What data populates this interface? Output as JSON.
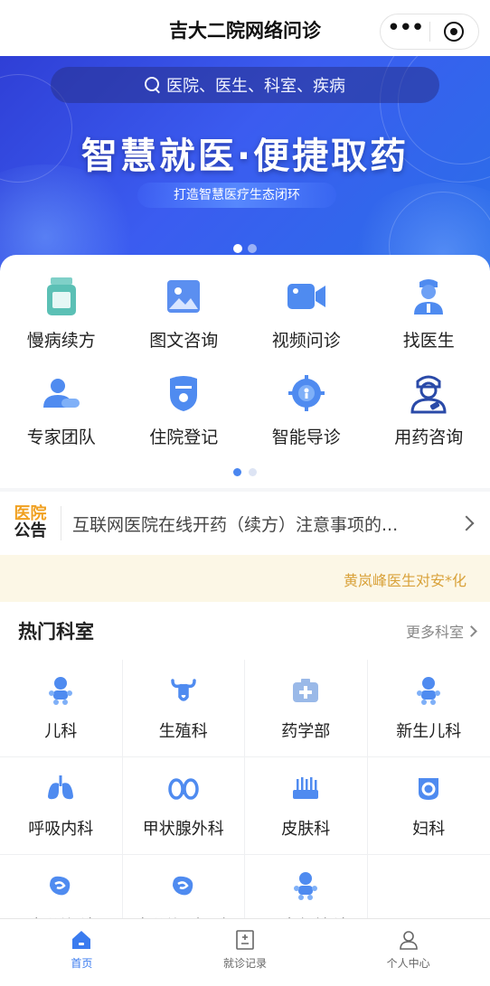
{
  "app": {
    "title": "吉大二院网络问诊"
  },
  "banner": {
    "search_placeholder": "医院、医生、科室、疾病",
    "slogan": "智慧就医·便捷取药",
    "subtitle": "打造智慧医疗生态闭环",
    "slide_count": 2,
    "active_slide": 1
  },
  "services": {
    "items": [
      {
        "label": "慢病续方",
        "icon": "medicine-bottle-icon"
      },
      {
        "label": "图文咨询",
        "icon": "image-icon"
      },
      {
        "label": "视频问诊",
        "icon": "video-camera-icon"
      },
      {
        "label": "找医生",
        "icon": "doctor-icon"
      },
      {
        "label": "专家团队",
        "icon": "team-icon"
      },
      {
        "label": "住院登记",
        "icon": "inpatient-badge-icon"
      },
      {
        "label": "智能导诊",
        "icon": "guide-target-icon"
      },
      {
        "label": "用药咨询",
        "icon": "nurse-icon"
      }
    ],
    "page_count": 2,
    "active_page": 1
  },
  "notice": {
    "tag_line1": "医院",
    "tag_line2": "公告",
    "text": "互联网医院在线开药（续方）注意事项的..."
  },
  "marquee": {
    "text": "黄岚峰医生对安*化"
  },
  "hot_departments": {
    "title": "热门科室",
    "more_label": "更多科室",
    "items": [
      {
        "label": "儿科",
        "icon": "baby-icon"
      },
      {
        "label": "生殖科",
        "icon": "uterus-icon"
      },
      {
        "label": "药学部",
        "icon": "medicine-box-icon"
      },
      {
        "label": "新生儿科",
        "icon": "newborn-icon"
      },
      {
        "label": "呼吸内科",
        "icon": "lungs-icon"
      },
      {
        "label": "甲状腺外科",
        "icon": "thyroid-icon"
      },
      {
        "label": "皮肤科",
        "icon": "skin-icon"
      },
      {
        "label": "妇科",
        "icon": "gynecology-icon"
      },
      {
        "label": "内分泌科",
        "icon": "digestive-icon"
      },
      {
        "label": "内分泌（亚泰",
        "icon": "digestive-icon"
      },
      {
        "label": "儿童保健科",
        "icon": "child-icon"
      }
    ]
  },
  "tabbar": {
    "items": [
      {
        "label": "首页",
        "icon": "home-icon",
        "active": true
      },
      {
        "label": "就诊记录",
        "icon": "record-icon",
        "active": false
      },
      {
        "label": "个人中心",
        "icon": "user-icon",
        "active": false
      }
    ]
  },
  "colors": {
    "accent": "#3a7bef",
    "banner_start": "#2f3fd6",
    "banner_end": "#2a6fe8",
    "notice_tag": "#f0a020",
    "marquee_bg": "#fcf7e6",
    "marquee_text": "#d9a23a"
  }
}
